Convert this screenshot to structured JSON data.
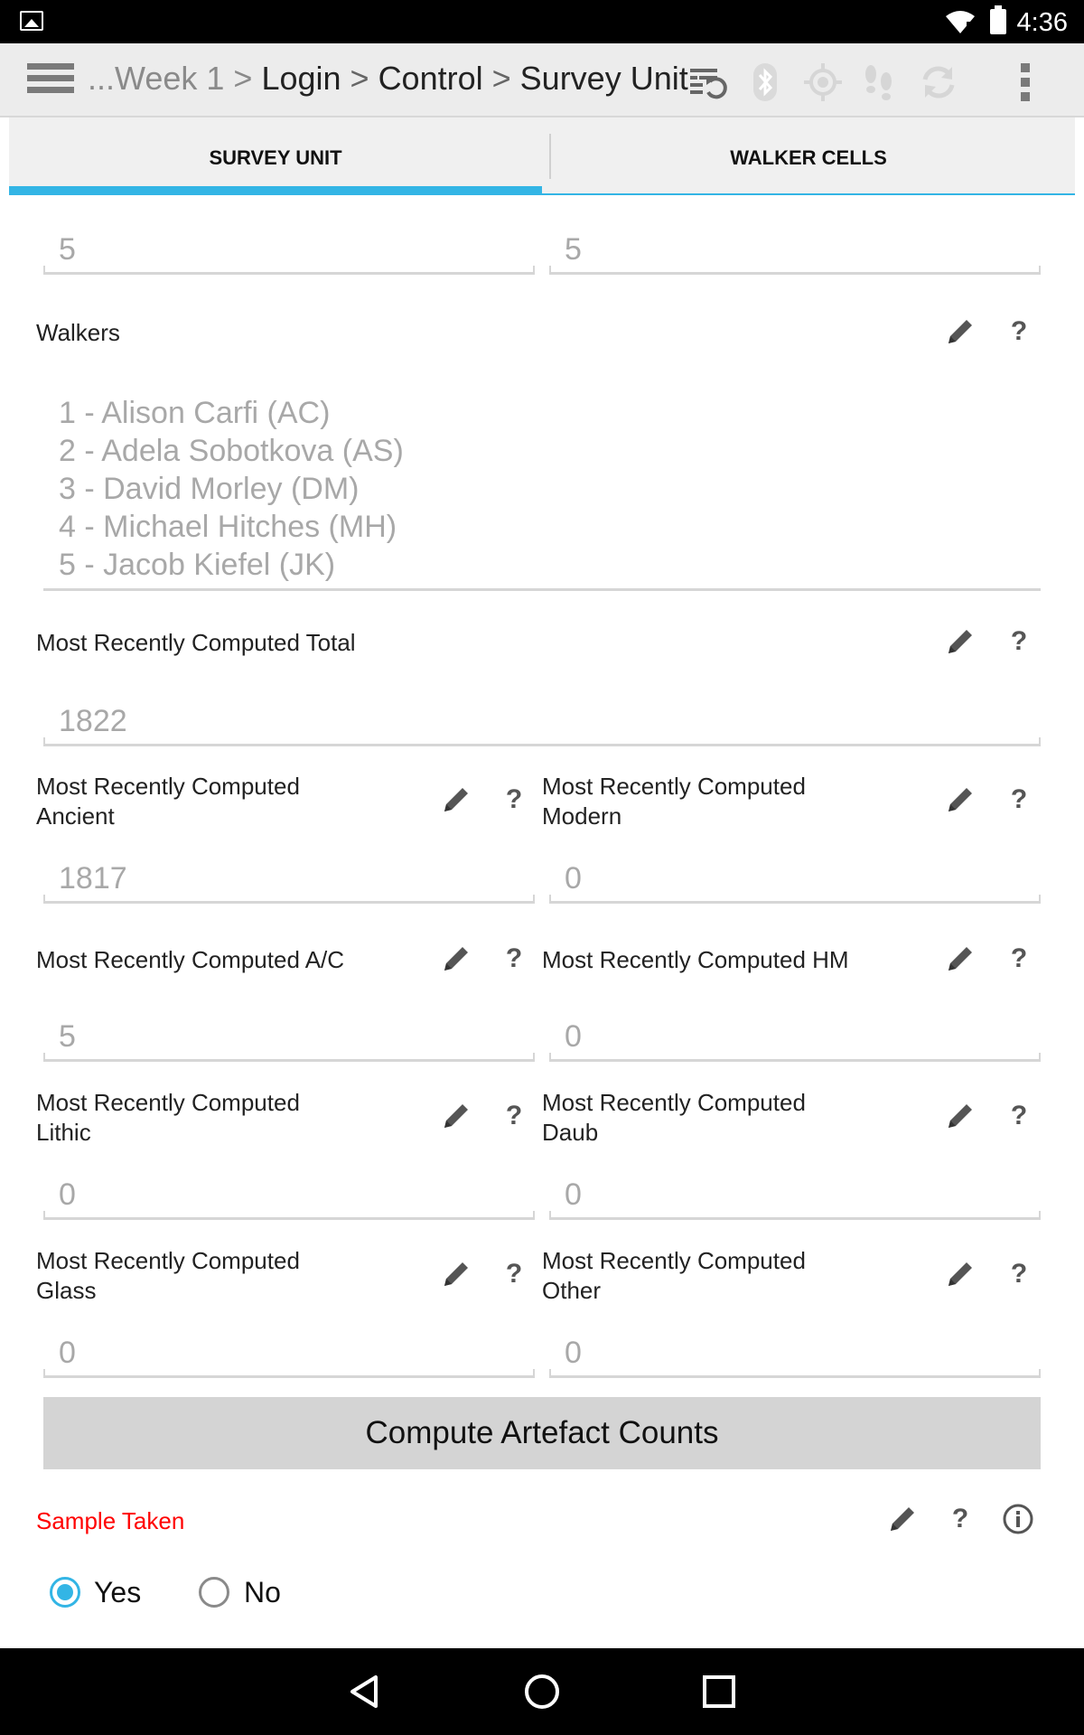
{
  "statusbar": {
    "time": "4:36"
  },
  "actionbar": {
    "breadcrumb_prefix": "...Week 1",
    "sep1": " > ",
    "crumb_login": "Login",
    "sep2": " > ",
    "crumb_control": "Control",
    "sep3": " > ",
    "crumb_current": "Survey Unit"
  },
  "tabs": {
    "active": "SURVEY UNIT",
    "inactive": "WALKER CELLS"
  },
  "form": {
    "top_left_value": "5",
    "top_right_value": "5",
    "walkers_label": "Walkers",
    "walkers": [
      "1 - Alison Carfi (AC)",
      "2 - Adela Sobotkova (AS)",
      "3 - David Morley (DM)",
      "4 - Michael Hitches (MH)",
      "5 - Jacob Kiefel (JK)"
    ],
    "total_label": "Most Recently Computed Total",
    "total_value": "1822",
    "ancient_label_1": "Most Recently Computed",
    "ancient_label_2": "Ancient",
    "ancient_value": "1817",
    "modern_label_1": "Most Recently Computed",
    "modern_label_2": "Modern",
    "modern_value": "0",
    "ac_label": "Most Recently Computed A/C",
    "ac_value": "5",
    "hm_label": "Most Recently Computed HM",
    "hm_value": "0",
    "lithic_label_1": "Most Recently Computed",
    "lithic_label_2": "Lithic",
    "lithic_value": "0",
    "daub_label_1": "Most Recently Computed",
    "daub_label_2": "Daub",
    "daub_value": "0",
    "glass_label_1": "Most Recently Computed",
    "glass_label_2": "Glass",
    "glass_value": "0",
    "other_label_1": "Most Recently Computed",
    "other_label_2": "Other",
    "other_value": "0",
    "compute_button": "Compute Artefact Counts",
    "sample_label": "Sample Taken",
    "sample_yes": "Yes",
    "sample_no": "No",
    "sample_selected": "Yes",
    "help_glyph": "?"
  },
  "colors": {
    "accent": "#33b5e5",
    "required": "#ff0000"
  }
}
